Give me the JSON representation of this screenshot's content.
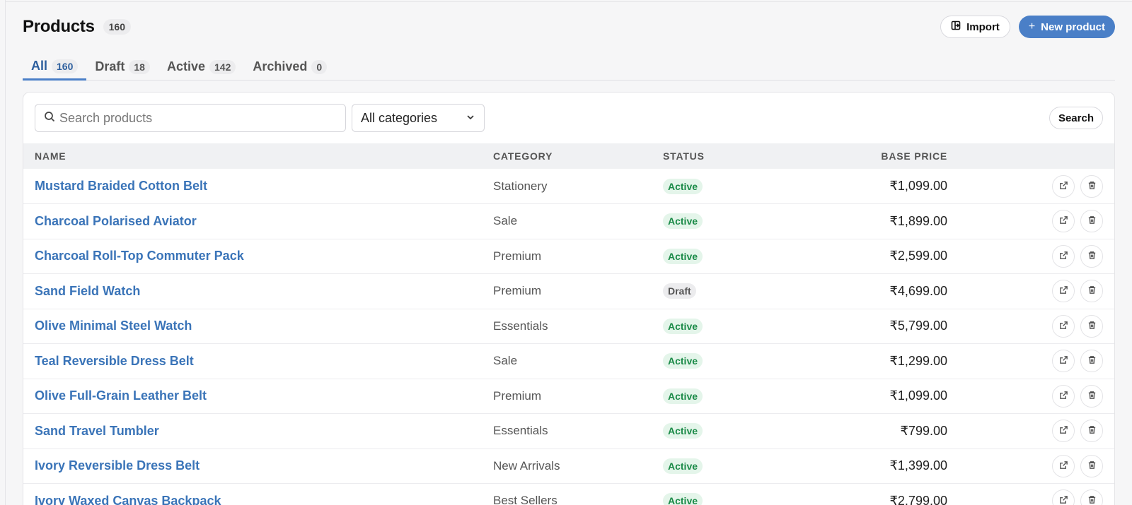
{
  "header": {
    "title": "Products",
    "count": "160",
    "import_label": "Import",
    "new_label": "New product"
  },
  "tabs": [
    {
      "label": "All",
      "count": "160"
    },
    {
      "label": "Draft",
      "count": "18"
    },
    {
      "label": "Active",
      "count": "142"
    },
    {
      "label": "Archived",
      "count": "0"
    }
  ],
  "filters": {
    "search_placeholder": "Search products",
    "category_value": "All categories",
    "search_button": "Search"
  },
  "table": {
    "columns": {
      "name": "NAME",
      "category": "CATEGORY",
      "status": "STATUS",
      "price": "BASE PRICE"
    },
    "rows": [
      {
        "name": "Mustard Braided Cotton Belt",
        "category": "Stationery",
        "status": "Active",
        "price": "₹1,099.00"
      },
      {
        "name": "Charcoal Polarised Aviator",
        "category": "Sale",
        "status": "Active",
        "price": "₹1,899.00"
      },
      {
        "name": "Charcoal Roll-Top Commuter Pack",
        "category": "Premium",
        "status": "Active",
        "price": "₹2,599.00"
      },
      {
        "name": "Sand Field Watch",
        "category": "Premium",
        "status": "Draft",
        "price": "₹4,699.00"
      },
      {
        "name": "Olive Minimal Steel Watch",
        "category": "Essentials",
        "status": "Active",
        "price": "₹5,799.00"
      },
      {
        "name": "Teal Reversible Dress Belt",
        "category": "Sale",
        "status": "Active",
        "price": "₹1,299.00"
      },
      {
        "name": "Olive Full-Grain Leather Belt",
        "category": "Premium",
        "status": "Active",
        "price": "₹1,099.00"
      },
      {
        "name": "Sand Travel Tumbler",
        "category": "Essentials",
        "status": "Active",
        "price": "₹799.00"
      },
      {
        "name": "Ivory Reversible Dress Belt",
        "category": "New Arrivals",
        "status": "Active",
        "price": "₹1,399.00"
      },
      {
        "name": "Ivory Waxed Canvas Backpack",
        "category": "Best Sellers",
        "status": "Active",
        "price": "₹2,799.00"
      }
    ]
  },
  "colors": {
    "accent": "#4a7fc7",
    "link": "#3a74b8",
    "active_badge_bg": "#e4f5ea",
    "active_badge_text": "#1a8a47",
    "draft_badge_bg": "#ececee"
  }
}
